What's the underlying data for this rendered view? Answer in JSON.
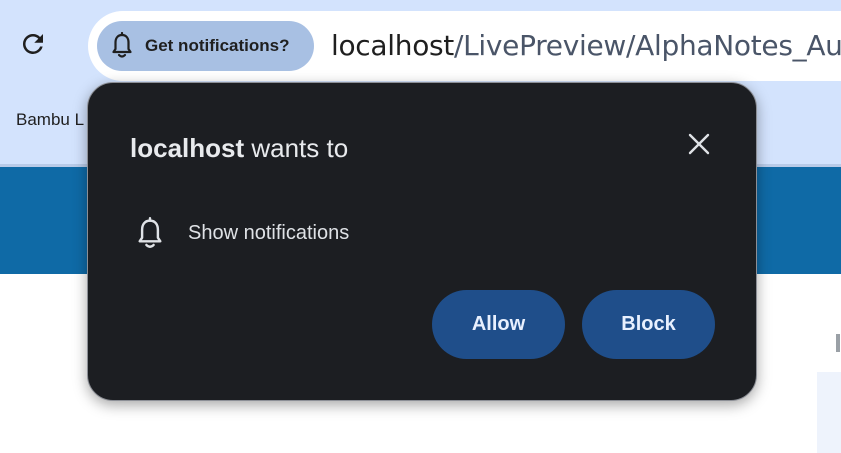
{
  "toolbar": {
    "reload_icon": "reload-icon",
    "notification_chip": {
      "icon": "bell-icon",
      "label": "Get notifications?"
    },
    "url": {
      "host": "localhost",
      "path": "/LivePreview/AlphaNotes_Auth"
    }
  },
  "bookmarks": {
    "items": [
      {
        "label": "Bambu L"
      }
    ]
  },
  "popup": {
    "title_origin": "localhost",
    "title_suffix": " wants to",
    "close_icon": "close-icon",
    "permission": {
      "icon": "bell-icon",
      "label": "Show notifications"
    },
    "allow_label": "Allow",
    "block_label": "Block"
  },
  "colors": {
    "chrome_bg": "#d3e3fd",
    "chip_bg": "#a8c0e3",
    "page_header": "#0f6aa6",
    "popup_bg": "#1c1e22",
    "button_bg": "#1f4e8a",
    "button_text": "#e8f0fe"
  }
}
